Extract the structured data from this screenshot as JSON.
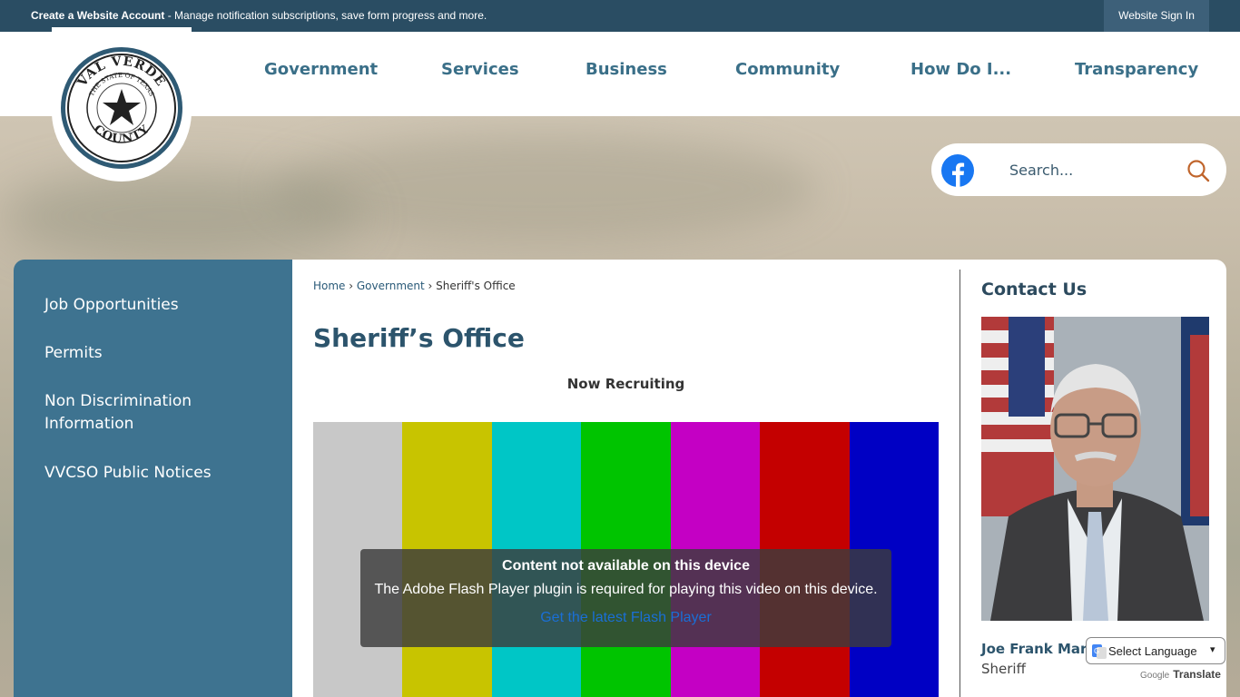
{
  "topbar": {
    "account_link": "Create a Website Account",
    "account_desc": " - Manage notification subscriptions, save form progress and more.",
    "sign_in": "Website Sign In"
  },
  "logo": {
    "top_text": "VAL VERDE",
    "ring_text": "THE STATE OF TEXAS",
    "bottom_text": "COUNTY"
  },
  "nav": [
    "Government",
    "Services",
    "Business",
    "Community",
    "How Do I...",
    "Transparency"
  ],
  "search": {
    "placeholder": "Search..."
  },
  "sidebar": {
    "items": [
      "Job Opportunities",
      "Permits",
      "Non Discrimination Information",
      "VVCSO Public Notices"
    ]
  },
  "breadcrumb": {
    "home": "Home",
    "sep1": " › ",
    "section": "Government",
    "sep2": " › ",
    "current": "Sheriff's Office"
  },
  "page": {
    "title": "Sheriff’s Office",
    "subhead": "Now Recruiting"
  },
  "video": {
    "bars": [
      "#c8c8c8",
      "#c8c400",
      "#00c6c6",
      "#00c400",
      "#c400c4",
      "#c40000",
      "#0000c4"
    ],
    "notice_title": "Content not available on this device",
    "notice_text": "The Adobe Flash Player plugin is required for playing this video on this device.",
    "notice_link": "Get the latest Flash Player"
  },
  "contact": {
    "title": "Contact Us",
    "name": "Joe Frank Mar",
    "role": "Sheriff"
  },
  "translate": {
    "select_label": "Select Language",
    "powered_google": "Google",
    "powered_translate": "Translate"
  }
}
